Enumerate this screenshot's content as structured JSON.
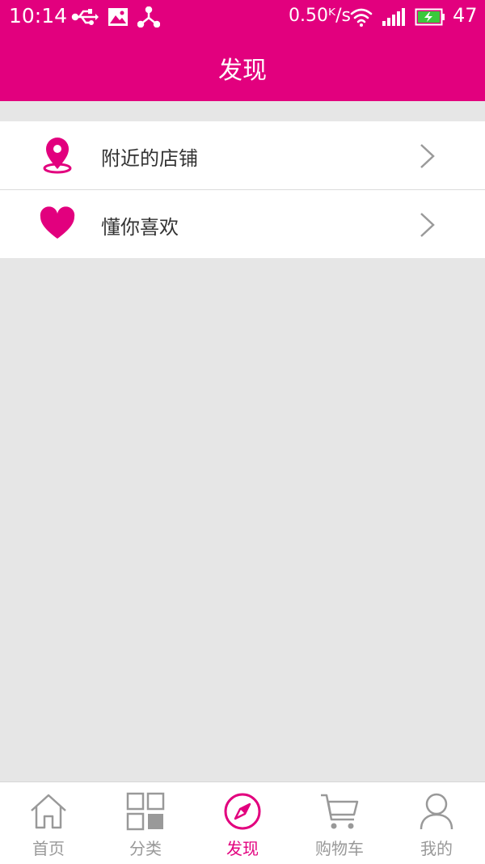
{
  "status_bar": {
    "time": "10:14",
    "speed": "0.50ᴷ/s",
    "battery": "47",
    "icons": [
      "usb-icon",
      "image-icon",
      "share-icon",
      "wifi-icon",
      "signal-icon",
      "battery-charging-icon"
    ]
  },
  "header": {
    "title": "发现"
  },
  "menu": {
    "items": [
      {
        "label": "附近的店铺",
        "icon": "location-pin-icon"
      },
      {
        "label": "懂你喜欢",
        "icon": "heart-icon"
      }
    ]
  },
  "tabbar": {
    "items": [
      {
        "label": "首页",
        "icon": "home-icon",
        "active": false
      },
      {
        "label": "分类",
        "icon": "grid-icon",
        "active": false
      },
      {
        "label": "发现",
        "icon": "compass-icon",
        "active": true
      },
      {
        "label": "购物车",
        "icon": "cart-icon",
        "active": false
      },
      {
        "label": "我的",
        "icon": "user-icon",
        "active": false
      }
    ]
  },
  "colors": {
    "brand": "#e2007e",
    "inactive": "#999999",
    "background": "#e6e6e6"
  }
}
